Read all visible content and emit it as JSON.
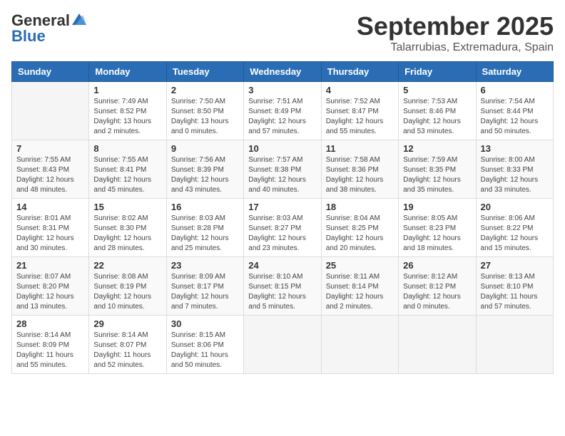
{
  "header": {
    "logo_general": "General",
    "logo_blue": "Blue",
    "month": "September 2025",
    "location": "Talarrubias, Extremadura, Spain"
  },
  "weekdays": [
    "Sunday",
    "Monday",
    "Tuesday",
    "Wednesday",
    "Thursday",
    "Friday",
    "Saturday"
  ],
  "weeks": [
    [
      {
        "day": "",
        "info": ""
      },
      {
        "day": "1",
        "info": "Sunrise: 7:49 AM\nSunset: 8:52 PM\nDaylight: 13 hours\nand 2 minutes."
      },
      {
        "day": "2",
        "info": "Sunrise: 7:50 AM\nSunset: 8:50 PM\nDaylight: 13 hours\nand 0 minutes."
      },
      {
        "day": "3",
        "info": "Sunrise: 7:51 AM\nSunset: 8:49 PM\nDaylight: 12 hours\nand 57 minutes."
      },
      {
        "day": "4",
        "info": "Sunrise: 7:52 AM\nSunset: 8:47 PM\nDaylight: 12 hours\nand 55 minutes."
      },
      {
        "day": "5",
        "info": "Sunrise: 7:53 AM\nSunset: 8:46 PM\nDaylight: 12 hours\nand 53 minutes."
      },
      {
        "day": "6",
        "info": "Sunrise: 7:54 AM\nSunset: 8:44 PM\nDaylight: 12 hours\nand 50 minutes."
      }
    ],
    [
      {
        "day": "7",
        "info": "Sunrise: 7:55 AM\nSunset: 8:43 PM\nDaylight: 12 hours\nand 48 minutes."
      },
      {
        "day": "8",
        "info": "Sunrise: 7:55 AM\nSunset: 8:41 PM\nDaylight: 12 hours\nand 45 minutes."
      },
      {
        "day": "9",
        "info": "Sunrise: 7:56 AM\nSunset: 8:39 PM\nDaylight: 12 hours\nand 43 minutes."
      },
      {
        "day": "10",
        "info": "Sunrise: 7:57 AM\nSunset: 8:38 PM\nDaylight: 12 hours\nand 40 minutes."
      },
      {
        "day": "11",
        "info": "Sunrise: 7:58 AM\nSunset: 8:36 PM\nDaylight: 12 hours\nand 38 minutes."
      },
      {
        "day": "12",
        "info": "Sunrise: 7:59 AM\nSunset: 8:35 PM\nDaylight: 12 hours\nand 35 minutes."
      },
      {
        "day": "13",
        "info": "Sunrise: 8:00 AM\nSunset: 8:33 PM\nDaylight: 12 hours\nand 33 minutes."
      }
    ],
    [
      {
        "day": "14",
        "info": "Sunrise: 8:01 AM\nSunset: 8:31 PM\nDaylight: 12 hours\nand 30 minutes."
      },
      {
        "day": "15",
        "info": "Sunrise: 8:02 AM\nSunset: 8:30 PM\nDaylight: 12 hours\nand 28 minutes."
      },
      {
        "day": "16",
        "info": "Sunrise: 8:03 AM\nSunset: 8:28 PM\nDaylight: 12 hours\nand 25 minutes."
      },
      {
        "day": "17",
        "info": "Sunrise: 8:03 AM\nSunset: 8:27 PM\nDaylight: 12 hours\nand 23 minutes."
      },
      {
        "day": "18",
        "info": "Sunrise: 8:04 AM\nSunset: 8:25 PM\nDaylight: 12 hours\nand 20 minutes."
      },
      {
        "day": "19",
        "info": "Sunrise: 8:05 AM\nSunset: 8:23 PM\nDaylight: 12 hours\nand 18 minutes."
      },
      {
        "day": "20",
        "info": "Sunrise: 8:06 AM\nSunset: 8:22 PM\nDaylight: 12 hours\nand 15 minutes."
      }
    ],
    [
      {
        "day": "21",
        "info": "Sunrise: 8:07 AM\nSunset: 8:20 PM\nDaylight: 12 hours\nand 13 minutes."
      },
      {
        "day": "22",
        "info": "Sunrise: 8:08 AM\nSunset: 8:19 PM\nDaylight: 12 hours\nand 10 minutes."
      },
      {
        "day": "23",
        "info": "Sunrise: 8:09 AM\nSunset: 8:17 PM\nDaylight: 12 hours\nand 7 minutes."
      },
      {
        "day": "24",
        "info": "Sunrise: 8:10 AM\nSunset: 8:15 PM\nDaylight: 12 hours\nand 5 minutes."
      },
      {
        "day": "25",
        "info": "Sunrise: 8:11 AM\nSunset: 8:14 PM\nDaylight: 12 hours\nand 2 minutes."
      },
      {
        "day": "26",
        "info": "Sunrise: 8:12 AM\nSunset: 8:12 PM\nDaylight: 12 hours\nand 0 minutes."
      },
      {
        "day": "27",
        "info": "Sunrise: 8:13 AM\nSunset: 8:10 PM\nDaylight: 11 hours\nand 57 minutes."
      }
    ],
    [
      {
        "day": "28",
        "info": "Sunrise: 8:14 AM\nSunset: 8:09 PM\nDaylight: 11 hours\nand 55 minutes."
      },
      {
        "day": "29",
        "info": "Sunrise: 8:14 AM\nSunset: 8:07 PM\nDaylight: 11 hours\nand 52 minutes."
      },
      {
        "day": "30",
        "info": "Sunrise: 8:15 AM\nSunset: 8:06 PM\nDaylight: 11 hours\nand 50 minutes."
      },
      {
        "day": "",
        "info": ""
      },
      {
        "day": "",
        "info": ""
      },
      {
        "day": "",
        "info": ""
      },
      {
        "day": "",
        "info": ""
      }
    ]
  ]
}
